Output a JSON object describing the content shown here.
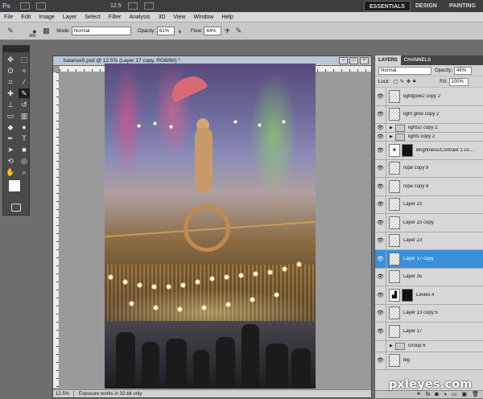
{
  "app": {
    "logo": "Ps",
    "zoom_label": "12.5"
  },
  "workspaces": {
    "essentials": "ESSENTIALS",
    "design": "DESIGN",
    "painting": "PAINTING"
  },
  "menu": [
    "File",
    "Edit",
    "Image",
    "Layer",
    "Select",
    "Filter",
    "Analysis",
    "3D",
    "View",
    "Window",
    "Help"
  ],
  "options": {
    "brush_size": "400",
    "mode_label": "Mode:",
    "mode_value": "Normal",
    "opacity_label": "Opacity:",
    "opacity_value": "61%",
    "flow_label": "Flow:",
    "flow_value": "44%"
  },
  "document": {
    "title": "balance5.psd @ 12.5% (Layer 17 copy, RGB/8#) *",
    "status_zoom": "12.5%",
    "status_message": "Exposure works in 32-bit only"
  },
  "panel": {
    "tabs": [
      "LAYERS",
      "CHANNELS"
    ],
    "blend_mode": "Normal",
    "opacity_label": "Opacity:",
    "opacity_value": "46%",
    "lock_label": "Lock:",
    "fill_label": "Fill:",
    "fill_value": "100%",
    "footer_icons": [
      "link-icon",
      "fx-icon",
      "mask-icon",
      "adjustment-icon",
      "folder-icon",
      "new-layer-icon",
      "trash-icon"
    ]
  },
  "layers": [
    {
      "name": "lightglow2 copy 2",
      "type": "layer",
      "visible": true
    },
    {
      "name": "light glow copy 2",
      "type": "layer",
      "visible": true
    },
    {
      "name": "lights2 copy 2",
      "type": "group",
      "visible": true
    },
    {
      "name": "lights copy 2",
      "type": "group",
      "visible": true
    },
    {
      "name": "Brightness/Contrast 1 co...",
      "type": "adjustment",
      "visible": true
    },
    {
      "name": "rope copy 9",
      "type": "layer",
      "visible": true
    },
    {
      "name": "rope copy 8",
      "type": "layer",
      "visible": true
    },
    {
      "name": "Layer 22",
      "type": "layer",
      "visible": true
    },
    {
      "name": "Layer 23 copy",
      "type": "layer",
      "visible": true
    },
    {
      "name": "Layer 23",
      "type": "layer",
      "visible": true
    },
    {
      "name": "Layer 17 copy",
      "type": "layer",
      "visible": true,
      "selected": true
    },
    {
      "name": "Layer 35",
      "type": "layer",
      "visible": true
    },
    {
      "name": "Levels 4",
      "type": "adjustment",
      "visible": true
    },
    {
      "name": "Layer 13 copy 5",
      "type": "layer",
      "visible": true
    },
    {
      "name": "Layer 17",
      "type": "layer",
      "visible": true
    },
    {
      "name": "Group 6",
      "type": "group",
      "visible": false
    },
    {
      "name": "leg",
      "type": "layer",
      "visible": true
    }
  ],
  "watermark": "pxleyes.com",
  "colors": {
    "selected_layer": "#3a8fd9",
    "app_bar": "#3d3d3d"
  }
}
